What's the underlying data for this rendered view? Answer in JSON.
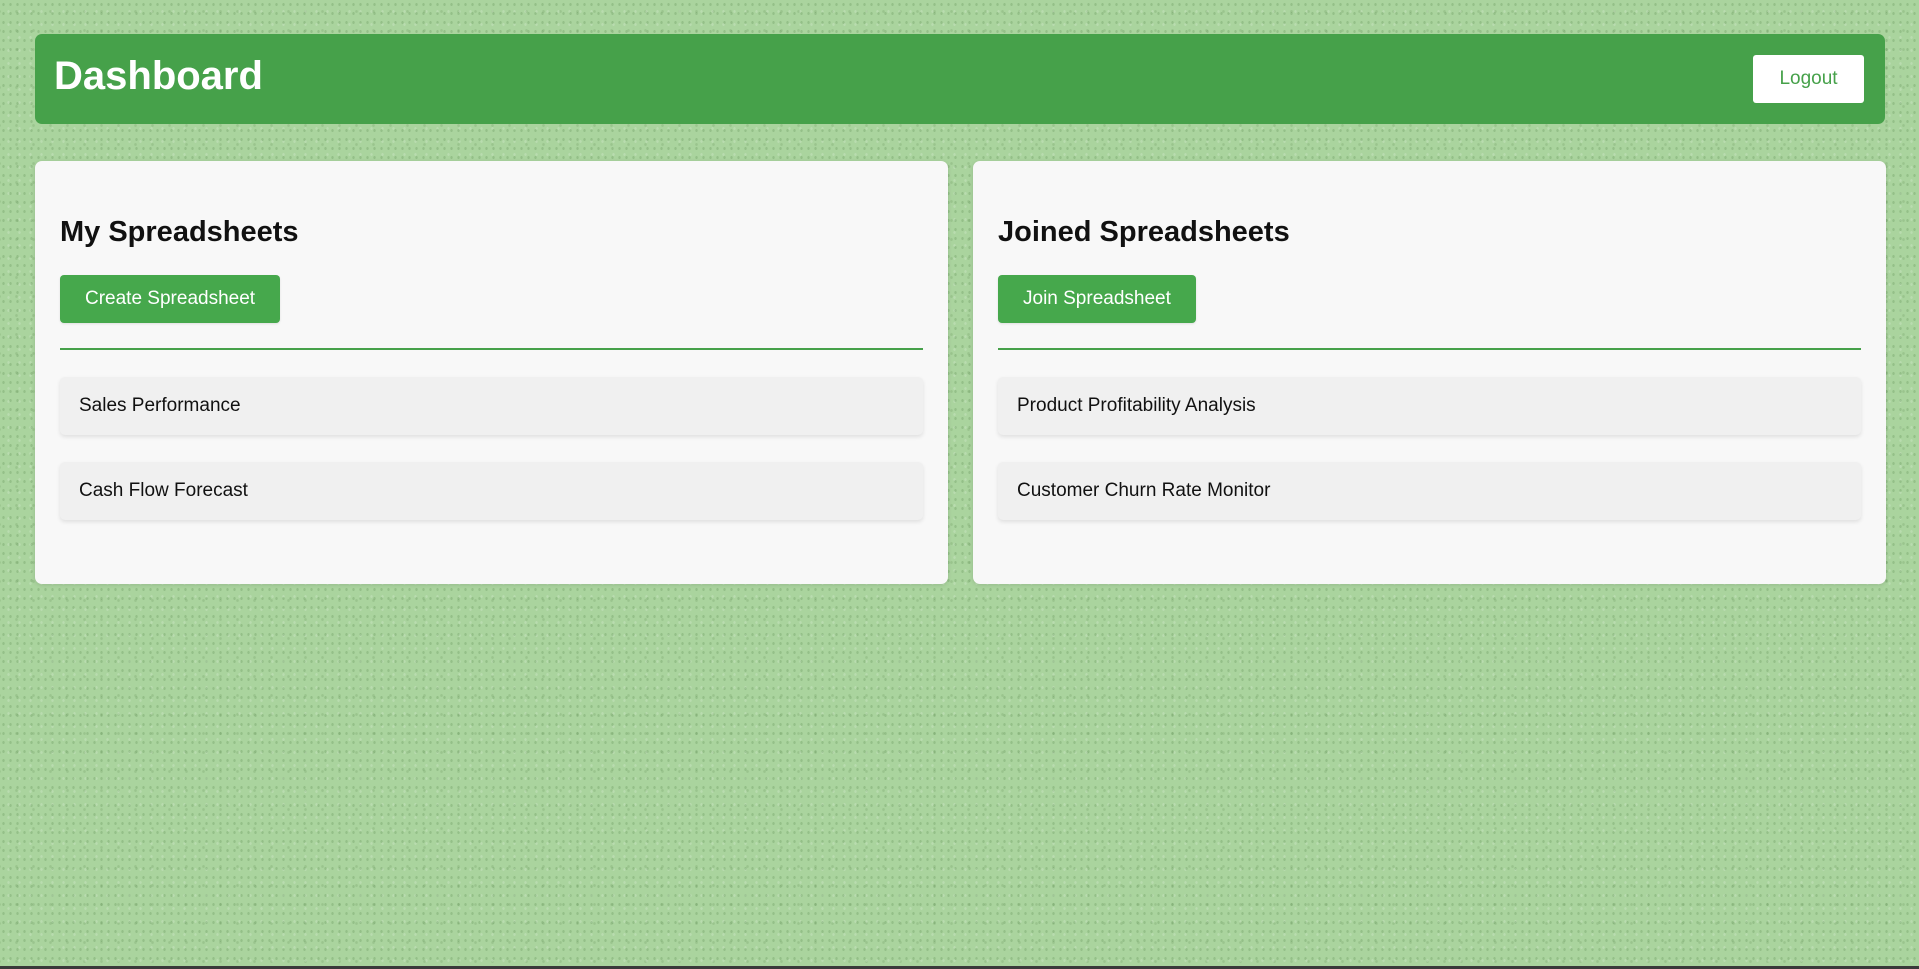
{
  "header": {
    "title": "Dashboard",
    "logout_label": "Logout"
  },
  "my_spreadsheets": {
    "heading": "My Spreadsheets",
    "button_label": "Create Spreadsheet",
    "items": [
      {
        "label": "Sales Performance"
      },
      {
        "label": "Cash Flow Forecast"
      }
    ]
  },
  "joined_spreadsheets": {
    "heading": "Joined Spreadsheets",
    "button_label": "Join Spreadsheet",
    "items": [
      {
        "label": "Product Profitability Analysis"
      },
      {
        "label": "Customer Churn Rate Monitor"
      }
    ]
  },
  "colors": {
    "accent": "#46a14a",
    "background": "#aad49e",
    "panel": "#f8f8f8",
    "list_item": "#f0f0f0"
  }
}
